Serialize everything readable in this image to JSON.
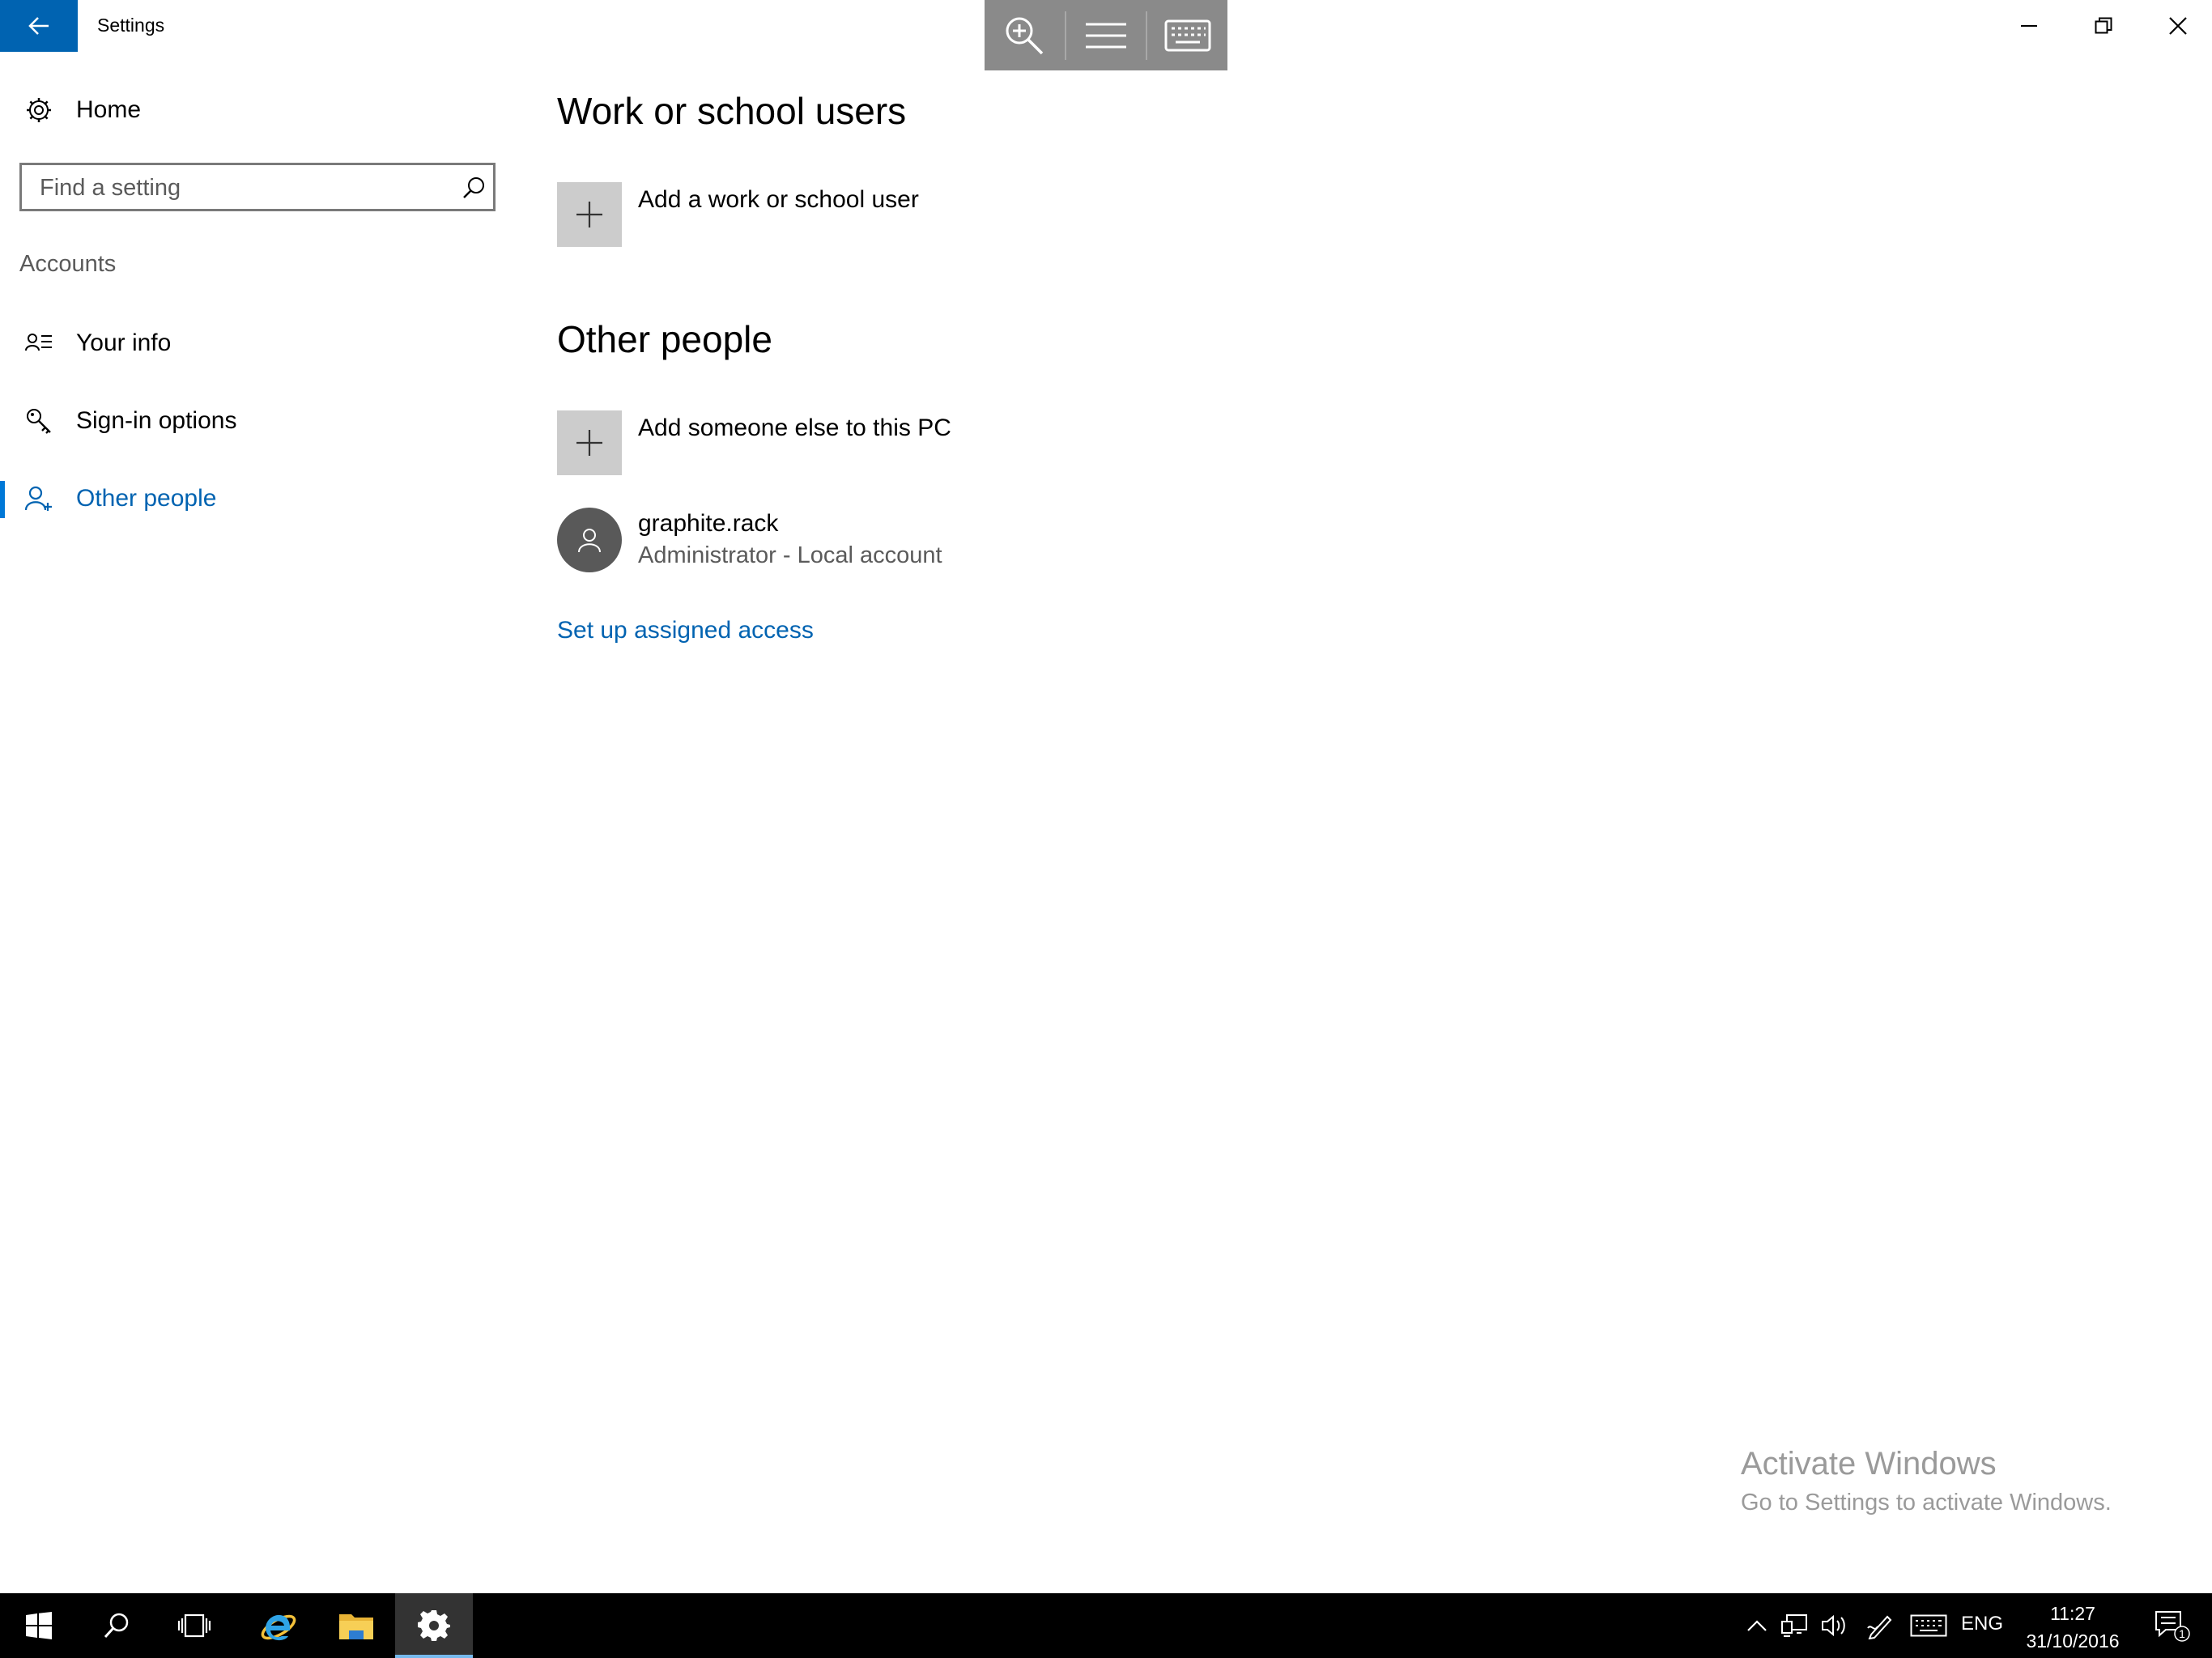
{
  "window": {
    "title": "Settings",
    "controls": [
      "minimize",
      "restore",
      "close"
    ]
  },
  "floating_toolbar": {
    "buttons": [
      "zoom-in",
      "menu",
      "keyboard"
    ]
  },
  "sidebar": {
    "home_label": "Home",
    "search": {
      "placeholder": "Find a setting",
      "value": ""
    },
    "section_label": "Accounts",
    "items": [
      {
        "label": "Your info",
        "icon": "contact-info-icon",
        "active": false
      },
      {
        "label": "Sign-in options",
        "icon": "key-icon",
        "active": false
      },
      {
        "label": "Other people",
        "icon": "add-person-icon",
        "active": true
      }
    ]
  },
  "main": {
    "work_school": {
      "heading": "Work or school users",
      "add_label": "Add a work or school user"
    },
    "other_people": {
      "heading": "Other people",
      "add_label": "Add someone else to this PC",
      "users": [
        {
          "name": "graphite.rack",
          "detail": "Administrator - Local account"
        }
      ],
      "assigned_access_link": "Set up assigned access"
    }
  },
  "watermark": {
    "title": "Activate Windows",
    "subtitle": "Go to Settings to activate Windows."
  },
  "taskbar": {
    "apps": [
      "start",
      "search",
      "task-view",
      "internet-explorer",
      "file-explorer",
      "settings"
    ],
    "active_app": "settings",
    "tray": {
      "language": "ENG",
      "time": "11:27",
      "date": "31/10/2016",
      "notification_count": "1"
    }
  },
  "colors": {
    "accent": "#0078d7",
    "link": "#0063b1",
    "tile": "#cccccc",
    "avatar": "#595959",
    "taskbar": "#000000"
  }
}
